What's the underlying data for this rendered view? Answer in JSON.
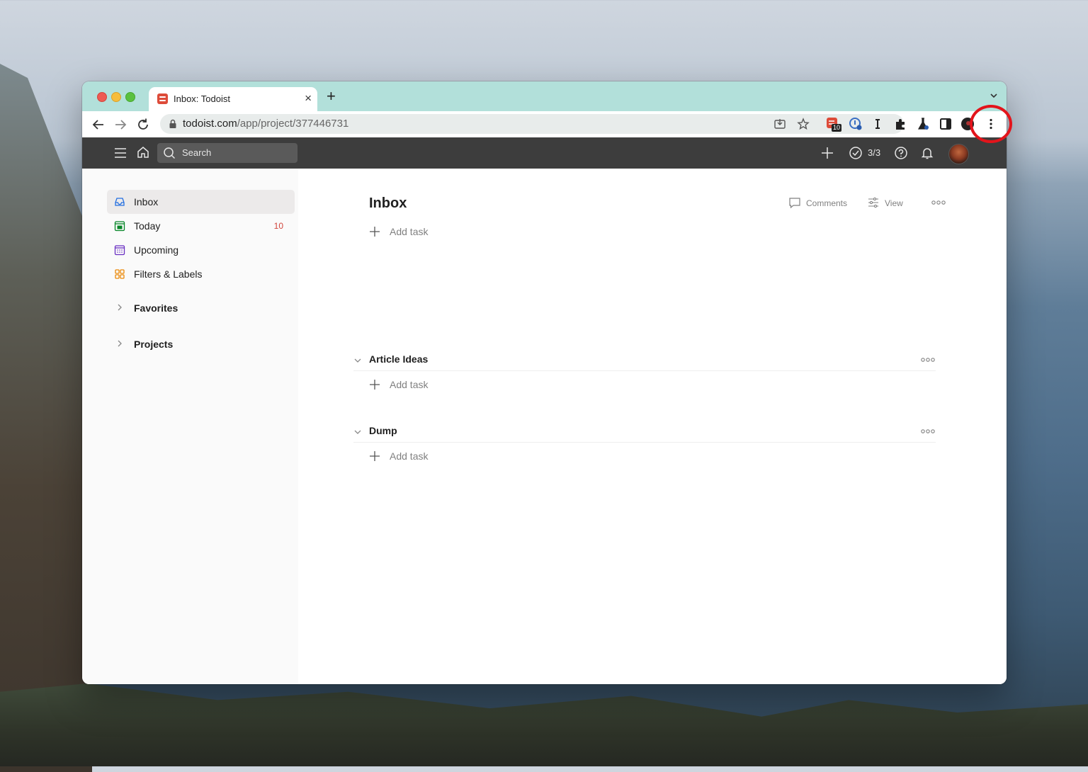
{
  "browser": {
    "tab_title": "Inbox: Todoist",
    "tab_close": "×",
    "new_tab": "+",
    "url_domain": "todoist.com",
    "url_path": "/app/project/377446731",
    "extension_badge": "10"
  },
  "app_header": {
    "search_placeholder": "Search",
    "karma": "3/3"
  },
  "sidebar": {
    "items": [
      {
        "label": "Inbox",
        "count": ""
      },
      {
        "label": "Today",
        "count": "10"
      },
      {
        "label": "Upcoming",
        "count": ""
      },
      {
        "label": "Filters & Labels",
        "count": ""
      }
    ],
    "groups": [
      {
        "label": "Favorites"
      },
      {
        "label": "Projects"
      }
    ]
  },
  "main": {
    "title": "Inbox",
    "comments_label": "Comments",
    "view_label": "View",
    "add_task_label": "Add task",
    "sections": [
      {
        "title": "Article Ideas"
      },
      {
        "title": "Dump"
      }
    ]
  },
  "colors": {
    "tabstrip": "#b2e0da",
    "appbar": "#3d3d3d",
    "accent_red": "#d1453b",
    "annotation_ring": "#e3141b"
  },
  "icons": [
    "back-icon",
    "forward-icon",
    "reload-icon",
    "lock-icon",
    "install-icon",
    "star-icon",
    "todoist-extension-icon",
    "onepassword-icon",
    "instapaper-icon",
    "puzzle-icon",
    "lab-icon",
    "sidepanel-icon",
    "profile-icon",
    "kebab-menu-icon",
    "hamburger-icon",
    "home-icon",
    "search-icon",
    "plus-icon",
    "check-circle-icon",
    "help-icon",
    "bell-icon"
  ]
}
